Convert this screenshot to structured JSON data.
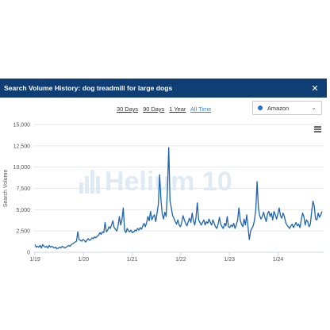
{
  "modal": {
    "title": "Search Volume History: dog treadmill for large dogs",
    "close_icon": "close-icon"
  },
  "ranges": [
    "30 Days",
    "90 Days",
    "1 Year",
    "All Time"
  ],
  "active_range": "All Time",
  "marketplace": {
    "selected": "Amazon",
    "dot_color": "#1e6fd0"
  },
  "watermark": "Helium 10",
  "colors": {
    "header": "#0e3e74",
    "line": "#1a64b0",
    "accent": "#1e88e5"
  },
  "chart_data": {
    "type": "line",
    "title": "",
    "xlabel": "",
    "ylabel": "Search Volume",
    "ylim": [
      0,
      15000
    ],
    "yticks": [
      0,
      2500,
      5000,
      7500,
      10000,
      12500,
      15000
    ],
    "ytick_labels": [
      "0",
      "2,500",
      "5,000",
      "7,500",
      "10,000",
      "12,500",
      "15,000"
    ],
    "xticks": [
      "1/19",
      "1/20",
      "1/21",
      "1/22",
      "1/23",
      "1/24"
    ],
    "grid": true,
    "series": [
      {
        "values": [
          900,
          600,
          700,
          600,
          800,
          500,
          900,
          700,
          600,
          700,
          500,
          800,
          600,
          700,
          600,
          500,
          600,
          400,
          500,
          600,
          500,
          700,
          600,
          500,
          600,
          700,
          800,
          700,
          900,
          1000,
          1100,
          1200,
          1300,
          2400,
          1500,
          1400,
          1300,
          1500,
          1400,
          1200,
          1400,
          1600,
          1400,
          1500,
          1700,
          1600,
          1800,
          1700,
          1900,
          2000,
          2300,
          2100,
          2400,
          2300,
          3500,
          2400,
          2600,
          3000,
          2800,
          3200,
          3700,
          2900,
          2700,
          2500,
          3100,
          4200,
          3200,
          3800,
          5200,
          2600,
          2300,
          2800,
          2500,
          2400,
          2600,
          2300,
          2400,
          2600,
          2500,
          2800,
          2600,
          2900,
          2700,
          3100,
          3400,
          3000,
          3500,
          4200,
          3700,
          4800,
          3800,
          4200,
          4400,
          3600,
          4600,
          5600,
          9100,
          6200,
          4500,
          3900,
          4700,
          4200,
          7300,
          12300,
          6000,
          5200,
          4300,
          4000,
          3600,
          3300,
          3800,
          3200,
          3000,
          3500,
          4300,
          3800,
          3400,
          3100,
          3600,
          4000,
          3500,
          4600,
          3700,
          3200,
          4100,
          5800,
          3800,
          3500,
          3200,
          3500,
          3800,
          3200,
          3600,
          3400,
          3900,
          3500,
          3200,
          3800,
          3400,
          3000,
          2800,
          3300,
          4100,
          3300,
          3000,
          2800,
          3400,
          3100,
          4200,
          3000,
          2900,
          3200,
          3000,
          3400,
          2800,
          3200,
          3800,
          5200,
          3800,
          3300,
          3000,
          3900,
          3200,
          4400,
          3000,
          1500,
          2500,
          2800,
          3100,
          3800,
          5000,
          8300,
          5200,
          4300,
          3900,
          4200,
          4700,
          4100,
          3600,
          4500,
          4800,
          4200,
          4600,
          3800,
          4800,
          4400,
          3900,
          4500,
          5200,
          4300,
          4000,
          4600,
          4200,
          3500,
          3200,
          3000,
          2800,
          3100,
          3300,
          2900,
          3200,
          3500,
          3100,
          3300,
          2900,
          3800,
          4600,
          4200,
          3200,
          3800,
          3600,
          3000,
          3300,
          4800,
          6000,
          5400,
          3900,
          3800,
          4600,
          4100,
          4400,
          4800
        ]
      }
    ]
  }
}
